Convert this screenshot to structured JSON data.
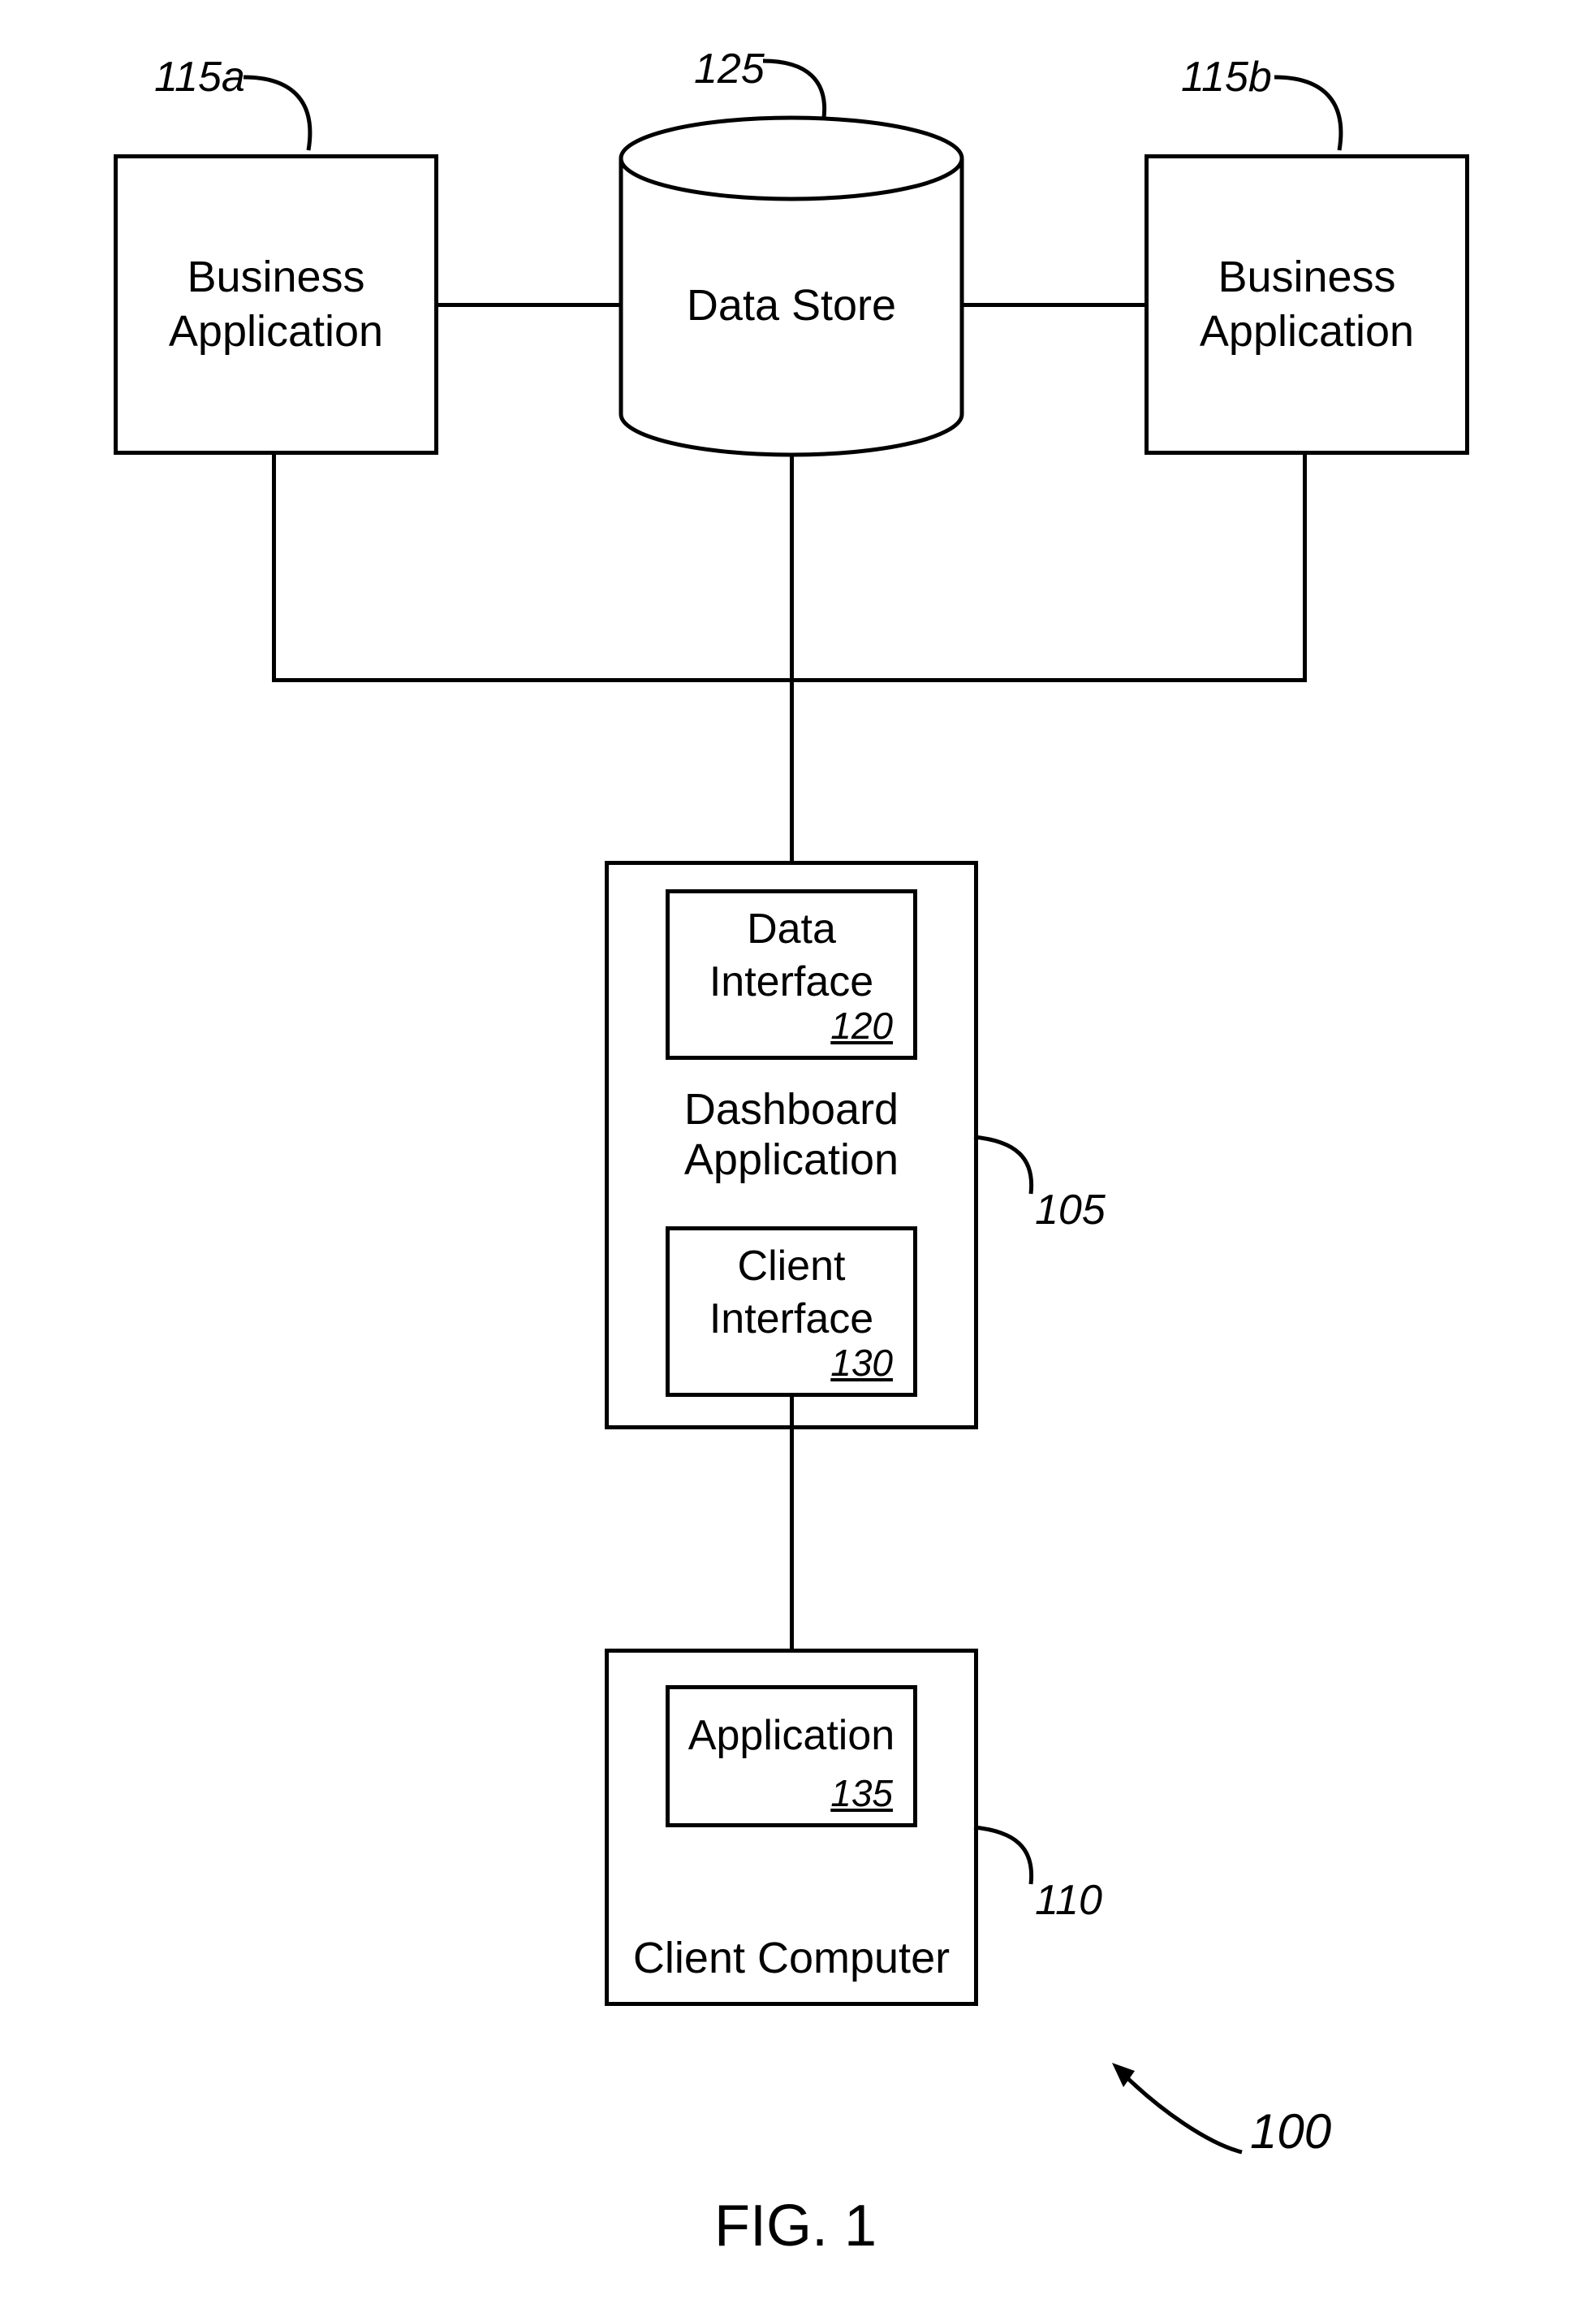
{
  "nodes": {
    "business_app_a": {
      "line1": "Business",
      "line2": "Application",
      "ref": "115a"
    },
    "business_app_b": {
      "line1": "Business",
      "line2": "Application",
      "ref": "115b"
    },
    "data_store": {
      "label": "Data Store",
      "ref": "125"
    },
    "dashboard": {
      "label_line1": "Dashboard",
      "label_line2": "Application",
      "ref": "105",
      "data_interface": {
        "line1": "Data",
        "line2": "Interface",
        "refnum": "120"
      },
      "client_interface": {
        "line1": "Client",
        "line2": "Interface",
        "refnum": "130"
      }
    },
    "client_computer": {
      "label": "Client Computer",
      "ref": "110",
      "application": {
        "label": "Application",
        "refnum": "135"
      }
    }
  },
  "figure_ref": "100",
  "figure_label": "FIG. 1"
}
